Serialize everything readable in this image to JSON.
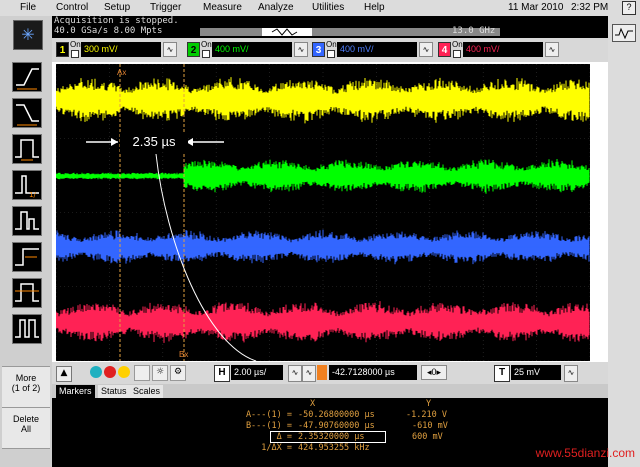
{
  "menu": {
    "items": [
      "File",
      "Control",
      "Setup",
      "Trigger",
      "Measure",
      "Analyze",
      "Utilities",
      "Help"
    ],
    "date": "11 Mar 2010",
    "time": "2:32 PM"
  },
  "status": {
    "line1": "Acquisition is stopped.",
    "line2": "40.0 GSa/s   8.00 Mpts",
    "bandwidth": "13.0 GHz"
  },
  "channels": [
    {
      "num": "1",
      "on": "On",
      "scale": "300 mV/",
      "color": "#ffff00"
    },
    {
      "num": "2",
      "on": "On",
      "scale": "400 mV/",
      "color": "#00ff00"
    },
    {
      "num": "3",
      "on": "On",
      "scale": "400 mV/",
      "color": "#3366ff"
    },
    {
      "num": "4",
      "on": "On",
      "scale": "400 mV/",
      "color": "#ff2255"
    }
  ],
  "screen": {
    "marker_ax": "Ax",
    "marker_bx": "Bx",
    "annotation": "2.35 µs",
    "ch_labels": [
      "1",
      "2",
      "3",
      "4"
    ]
  },
  "timebase": {
    "h_label": "H",
    "h_value": "2.00 µs/",
    "delay_value": "-42.7128000 µs",
    "delay_step": "0",
    "t_label": "T",
    "t_value": "25 mV"
  },
  "left": {
    "more_line1": "More",
    "more_line2": "(1 of 2)",
    "delete_line1": "Delete",
    "delete_line2": "All"
  },
  "tabs": [
    "Markers",
    "Status",
    "Scales"
  ],
  "markers": {
    "header_x": "X",
    "header_y": "Y",
    "rows": [
      {
        "label": "A---(1) =",
        "x": "-50.26800000 µs",
        "y": "-1.210 V"
      },
      {
        "label": "B---(1) =",
        "x": "-47.90760000 µs",
        "y": "-610 mV"
      },
      {
        "label": "Δ =",
        "x": "2.35320000 µs",
        "y": "600 mV"
      },
      {
        "label": "1/ΔX =",
        "x": "424.953255 kHz",
        "y": ""
      }
    ]
  },
  "watermark": "www.55dianzi.com",
  "colors": {
    "ch1": "#ffff00",
    "ch2": "#00ff00",
    "ch3": "#3366ff",
    "ch4": "#ff2255",
    "marker": "#e0a040"
  }
}
